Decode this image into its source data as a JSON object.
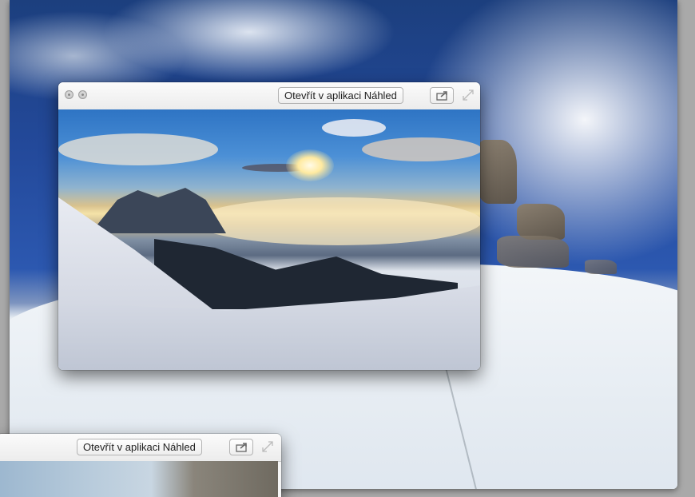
{
  "windows": {
    "main": {
      "open_label": "Otevřít v aplikaci Náhled"
    },
    "secondary": {
      "open_label": "Otevřít v aplikaci Náhled"
    }
  },
  "icons": {
    "share": "share-icon",
    "fullscreen": "fullscreen-icon",
    "close": "close-icon",
    "minimize": "minimize-icon"
  },
  "colors": {
    "toolbar": "#ececec",
    "sky": "#23499a",
    "snow": "#eef2f6"
  }
}
